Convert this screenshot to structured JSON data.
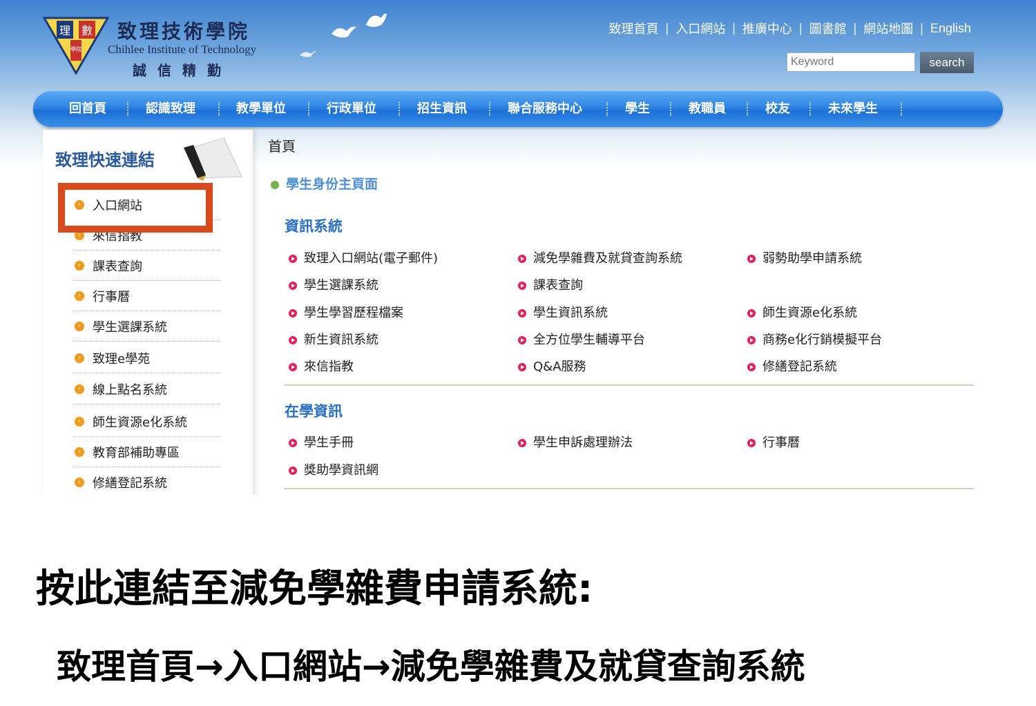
{
  "header": {
    "logo_name": "致理技術學院",
    "logo_en": "Chihlee Institute of Technology",
    "logo_motto": "誠信精勤",
    "logo_badge_left": "理",
    "logo_badge_right": "數",
    "logo_badge_bottom": "學院",
    "top_links": [
      "致理首頁",
      "入口網站",
      "推廣中心",
      "圖書館",
      "網站地圖",
      "English"
    ],
    "search_placeholder": "Keyword",
    "search_button": "search"
  },
  "nav": [
    "回首頁",
    "認識致理",
    "教學單位",
    "行政單位",
    "招生資訊",
    "聯合服務中心",
    "學生",
    "教職員",
    "校友",
    "未來學生"
  ],
  "sidebar": {
    "title": "致理快速連結",
    "items": [
      "入口網站",
      "來信指教",
      "課表查詢",
      "行事曆",
      "學生選課系統",
      "致理e學苑",
      "線上點名系統",
      "師生資源e化系統",
      "教育部補助專區",
      "修繕登記系統"
    ]
  },
  "main": {
    "breadcrumb": "首頁",
    "sub_heading": "學生身份主頁面",
    "sections": [
      {
        "title": "資訊系統",
        "links": [
          "致理入口網站(電子郵件)",
          "減免學雜費及就貸查詢系統",
          "弱勢助學申請系統",
          "學生選課系統",
          "課表查詢",
          "學生學習歷程檔案",
          "學生資訊系統",
          "師生資源e化系統",
          "新生資訊系統",
          "全方位學生輔導平台",
          "商務e化行銷模擬平台",
          "來信指教",
          "Q&A服務",
          "修繕登記系統"
        ]
      },
      {
        "title": "在學資訊",
        "links": [
          "學生手冊",
          "學生申訴處理辦法",
          "行事曆",
          "獎助學資訊網"
        ]
      }
    ]
  },
  "caption": {
    "line1": "按此連結至減免學雜費申請系統:",
    "line2": "致理首頁→入口網站→減免學雜費及就貸查詢系統"
  },
  "colors": {
    "nav_blue": "#2f84e3",
    "highlight": "#d84a1b",
    "section_title": "#2b6fc4",
    "link_dot": "#e2205a",
    "side_dot": "#f29a1c"
  }
}
